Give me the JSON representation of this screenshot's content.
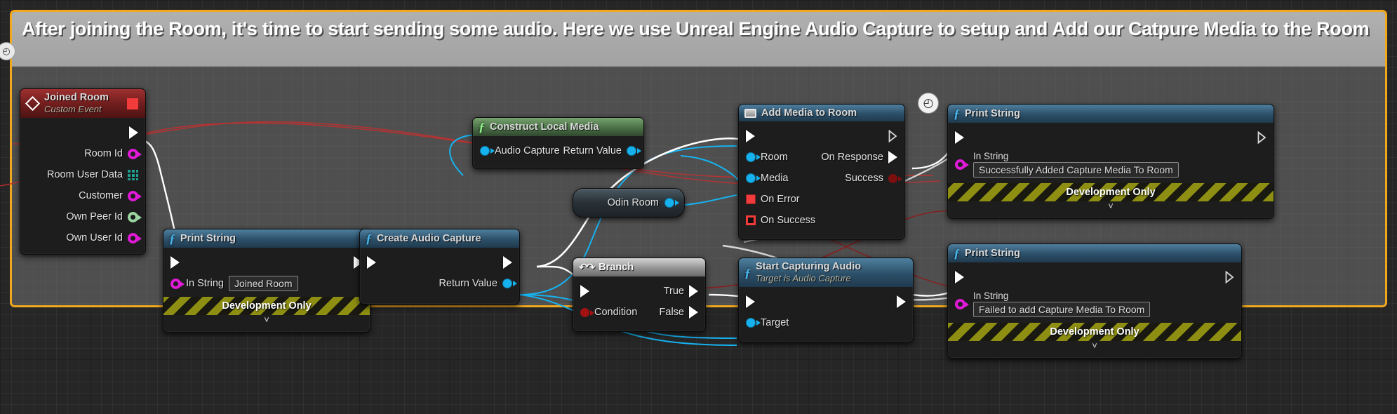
{
  "comment": {
    "text": "After joining the Room, it's time to start sending some audio. Here we use Unreal Engine Audio Capture to setup and Add our Catpure Media to the Room",
    "border_color": "#f0a81e",
    "bubble_icon": "clock-icon"
  },
  "nodes": {
    "joined_room": {
      "title": "Joined Room",
      "subtitle": "Custom Event",
      "icon": "event-diamond-icon",
      "outputs": [
        {
          "label": "Room Id",
          "pin": "string"
        },
        {
          "label": "Room User Data",
          "pin": "struct"
        },
        {
          "label": "Customer",
          "pin": "string"
        },
        {
          "label": "Own Peer Id",
          "pin": "name"
        },
        {
          "label": "Own User Id",
          "pin": "string"
        }
      ]
    },
    "print_string_joined": {
      "title": "Print String",
      "icon": "function-f-icon",
      "in_string_label": "In String",
      "in_string_value": "Joined Room",
      "footer": "Development Only"
    },
    "create_audio_capture": {
      "title": "Create Audio Capture",
      "icon": "function-f-icon",
      "outputs": [
        {
          "label": "Return Value",
          "pin": "object"
        }
      ]
    },
    "construct_local_media": {
      "title": "Construct Local Media",
      "icon": "function-f-pure-icon",
      "input_label": "Audio Capture",
      "output_label": "Return Value"
    },
    "odin_room": {
      "title": "Odin Room",
      "pin": "object"
    },
    "branch": {
      "title": "Branch",
      "icon": "branch-icon",
      "condition_label": "Condition",
      "true_label": "True",
      "false_label": "False"
    },
    "add_media_to_room": {
      "title": "Add Media to Room",
      "icon": "screen-icon",
      "inputs": [
        {
          "label": "Room",
          "pin": "object"
        },
        {
          "label": "Media",
          "pin": "object"
        },
        {
          "label": "On Error",
          "pin": "delegate"
        },
        {
          "label": "On Success",
          "pin": "delegate-hollow"
        }
      ],
      "outputs": [
        {
          "label": "On Response",
          "pin": "exec"
        },
        {
          "label": "Success",
          "pin": "bool"
        }
      ]
    },
    "start_capturing_audio": {
      "title": "Start Capturing Audio",
      "subtitle": "Target is Audio Capture",
      "icon": "function-f-icon",
      "target_label": "Target"
    },
    "print_string_success": {
      "title": "Print String",
      "icon": "function-f-icon",
      "in_string_label": "In String",
      "in_string_value": "Successfully Added Capture Media To Room",
      "footer": "Development Only"
    },
    "print_string_failed": {
      "title": "Print String",
      "icon": "function-f-icon",
      "in_string_label": "In String",
      "in_string_value": "Failed to add Capture Media To Room",
      "footer": "Development Only"
    }
  },
  "badges": {
    "watch_icon": "clock-icon"
  },
  "colors": {
    "exec_wire": "#ffffff",
    "object_wire": "#16b2ef",
    "string_wire": "#e11ad8",
    "bool_wire": "#a31212",
    "delegate_wire": "#f23b3b",
    "comment_border": "#f0a81e"
  }
}
